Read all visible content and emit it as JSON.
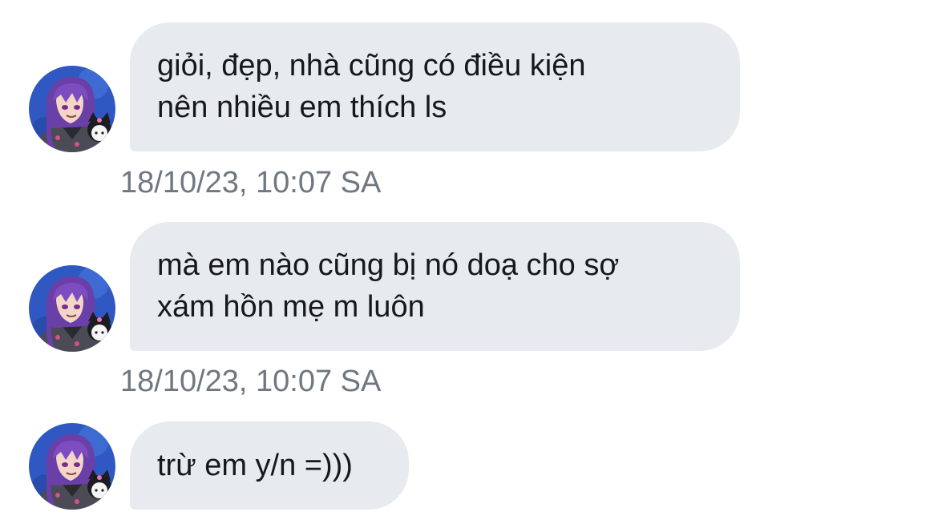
{
  "messages": [
    {
      "lines": [
        "giỏi, đẹp, nhà cũng có điều kiện",
        "nên nhiều em thích ls"
      ],
      "timestamp": "18/10/23, 10:07 SA"
    },
    {
      "lines": [
        "mà em nào cũng bị nó doạ cho sợ",
        "xám hồn mẹ m luôn"
      ],
      "timestamp": "18/10/23, 10:07 SA"
    },
    {
      "lines": [
        "trừ em y/n =)))"
      ]
    }
  ],
  "colors": {
    "bubble": "#e7eaee",
    "text": "#15181c",
    "timestamp": "#6f7781",
    "avatar_bg": "#3a63c9",
    "hair": "#6b3fa8"
  },
  "icons": {
    "avatar": "anime-character-with-kuromi-avatar"
  }
}
